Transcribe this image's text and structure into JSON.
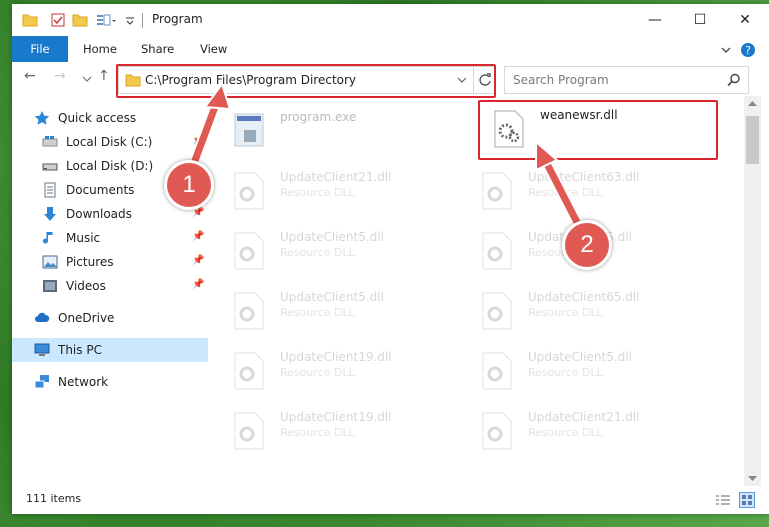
{
  "window": {
    "title": "Program",
    "controls": {
      "minimize": "—",
      "maximize": "☐",
      "close": "✕"
    }
  },
  "ribbon": {
    "tabs": [
      {
        "label": "File"
      },
      {
        "label": "Home"
      },
      {
        "label": "Share"
      },
      {
        "label": "View"
      }
    ]
  },
  "address": {
    "path": "C:\\Program Files\\Program Directory"
  },
  "search": {
    "placeholder": "Search Program"
  },
  "nav": {
    "items": [
      {
        "label": "Quick access",
        "icon": "star-icon"
      },
      {
        "label": "Local Disk (C:)",
        "icon": "drive-icon"
      },
      {
        "label": "Local Disk (D:)",
        "icon": "drive-icon"
      },
      {
        "label": "Documents",
        "icon": "documents-icon"
      },
      {
        "label": "Downloads",
        "icon": "download-icon"
      },
      {
        "label": "Music",
        "icon": "music-icon"
      },
      {
        "label": "Pictures",
        "icon": "pictures-icon"
      },
      {
        "label": "Videos",
        "icon": "videos-icon"
      },
      {
        "label": "OneDrive",
        "icon": "cloud-icon"
      },
      {
        "label": "This PC",
        "icon": "computer-icon"
      },
      {
        "label": "Network",
        "icon": "network-icon"
      }
    ]
  },
  "files": [
    {
      "name": "program.exe",
      "type": ""
    },
    {
      "name": "weanewsr.dll",
      "type": ""
    },
    {
      "name": "UpdateClient21.dll",
      "type": "Resource DLL"
    },
    {
      "name": "UpdateClient63.dll",
      "type": "Resource DLL"
    },
    {
      "name": "UpdateClient5.dll",
      "type": "Resource DLL"
    },
    {
      "name": "UpdateClient5.dll",
      "type": "Resource DLL"
    },
    {
      "name": "UpdateClient5.dll",
      "type": "Resource DLL"
    },
    {
      "name": "UpdateClient65.dll",
      "type": "Resource DLL"
    },
    {
      "name": "UpdateClient19.dll",
      "type": "Resource DLL"
    },
    {
      "name": "UpdateClient5.dll",
      "type": "Resource DLL"
    },
    {
      "name": "UpdateClient19.dll",
      "type": "Resource DLL"
    },
    {
      "name": "UpdateClient21.dll",
      "type": "Resource DLL"
    }
  ],
  "status": {
    "count": "111 items"
  },
  "callouts": {
    "one": "1",
    "two": "2"
  },
  "colors": {
    "accent": "#1979ca",
    "highlight": "#d9272d",
    "badge": "#e05a53",
    "selected_nav": "#cce8ff"
  }
}
